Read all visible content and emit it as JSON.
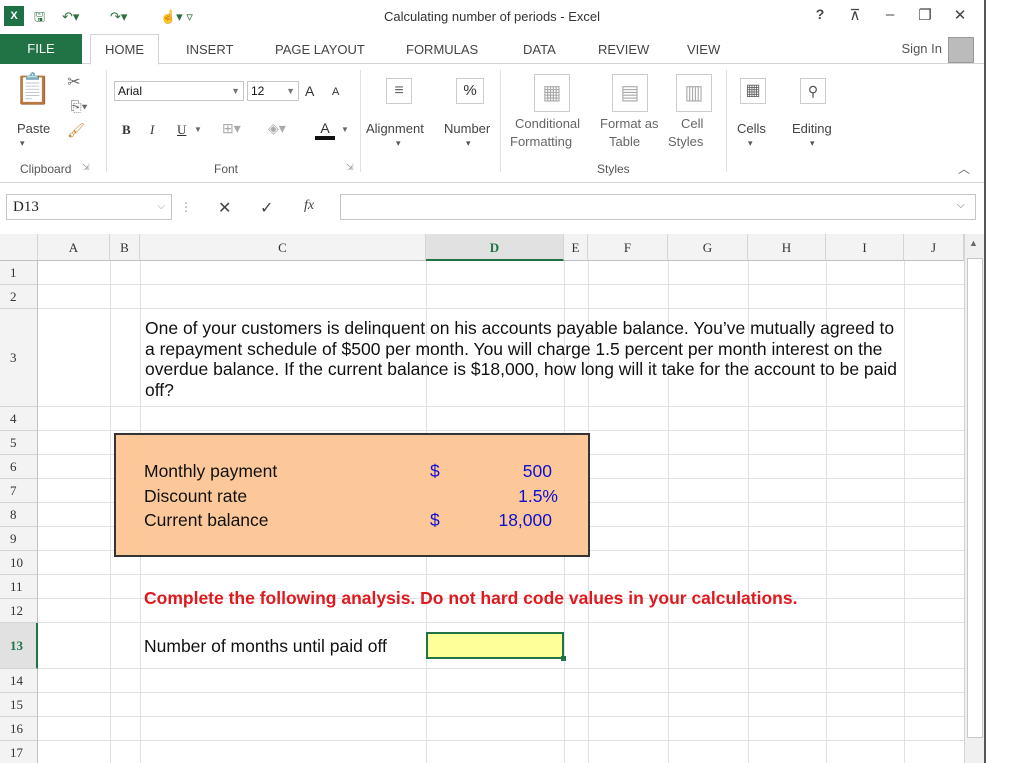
{
  "window": {
    "title": "Calculating number of periods - Excel",
    "app_logo": "X",
    "help": "?",
    "sign_in": "Sign In"
  },
  "tabs": [
    "FILE",
    "HOME",
    "INSERT",
    "PAGE LAYOUT",
    "FORMULAS",
    "DATA",
    "REVIEW",
    "VIEW"
  ],
  "ribbon": {
    "paste_label": "Paste",
    "clipboard_label": "Clipboard",
    "font_name": "Arial",
    "font_size": "12",
    "font_label": "Font",
    "bold": "B",
    "italic": "I",
    "underline": "U",
    "grow_font": "A",
    "shrink_font": "A",
    "font_color": "A",
    "alignment_label": "Alignment",
    "number_label": "Number",
    "percent": "%",
    "conditional_formatting": [
      "Conditional",
      "Formatting"
    ],
    "format_as_table": [
      "Format as",
      "Table"
    ],
    "cell_styles": [
      "Cell",
      "Styles"
    ],
    "styles_label": "Styles",
    "cells_label": "Cells",
    "editing_label": "Editing"
  },
  "formula_bar": {
    "name_box": "D13",
    "fx": "fx",
    "content": ""
  },
  "sheet": {
    "columns": [
      "A",
      "B",
      "C",
      "D",
      "E",
      "F",
      "G",
      "H",
      "I",
      "J"
    ],
    "rows": [
      "1",
      "2",
      "3",
      "4",
      "5",
      "6",
      "7",
      "8",
      "9",
      "10",
      "11",
      "12",
      "13",
      "14",
      "15",
      "16",
      "17"
    ],
    "selected_column": "D",
    "selected_row": "13",
    "problem_text": "One of your customers is delinquent on his accounts payable balance. You’ve mutually agreed to a repayment schedule of $500 per month. You will charge 1.5 percent per month interest on the overdue balance. If the current balance is $18,000, how long will it take for the account to be paid off?",
    "inputs": [
      {
        "label": "Monthly payment",
        "currency": "$",
        "value": "500"
      },
      {
        "label": "Discount rate",
        "currency": "",
        "value": "1.5%"
      },
      {
        "label": "Current balance",
        "currency": "$",
        "value": "18,000"
      }
    ],
    "instruction": "Complete the following analysis. Do not hard code values in your calculations.",
    "result_label": "Number of months until paid off",
    "result_value": ""
  }
}
